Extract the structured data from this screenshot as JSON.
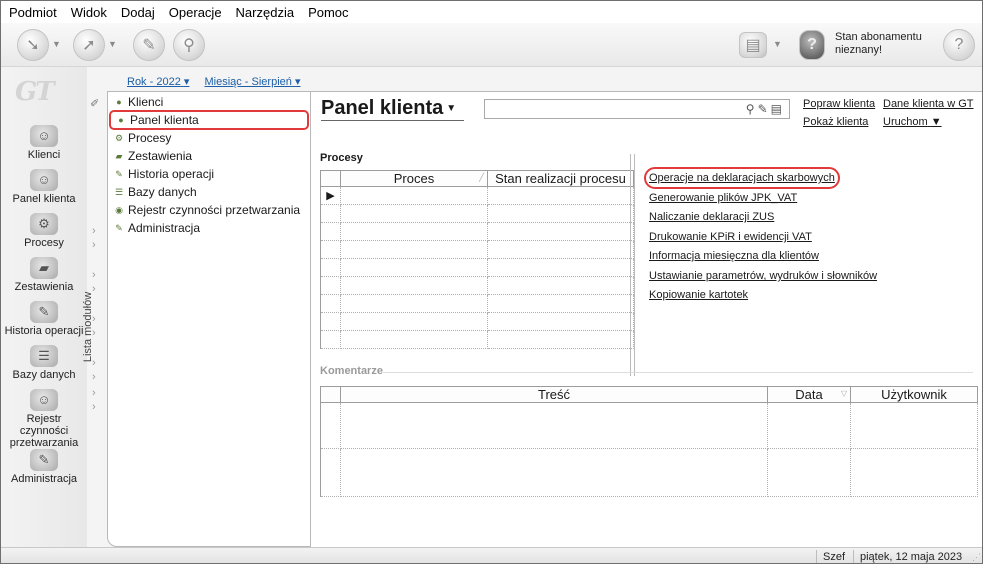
{
  "menu": [
    "Podmiot",
    "Widok",
    "Dodaj",
    "Operacje",
    "Narzędzia",
    "Pomoc"
  ],
  "subscription": {
    "line1": "Stan abonamentu",
    "line2": "nieznany!"
  },
  "logo": "GT",
  "nav": [
    {
      "label": "Klienci",
      "icon": "client-icon"
    },
    {
      "label": "Panel klienta",
      "icon": "client-panel-icon"
    },
    {
      "label": "Procesy",
      "icon": "gears-icon"
    },
    {
      "label": "Zestawienia",
      "icon": "report-icon"
    },
    {
      "label": "Historia operacji",
      "icon": "history-icon"
    },
    {
      "label": "Bazy danych",
      "icon": "database-icon"
    },
    {
      "label": "Rejestr czynności przetwarzania",
      "icon": "register-icon"
    },
    {
      "label": "Administracja",
      "icon": "admin-icon"
    }
  ],
  "module_strip_label": "Lista modułów",
  "filters": {
    "year": "Rok - 2022",
    "month": "Miesiąc - Sierpień"
  },
  "tree": [
    {
      "label": "Klienci",
      "selected": false
    },
    {
      "label": "Panel klienta",
      "selected": true
    },
    {
      "label": "Procesy",
      "selected": false
    },
    {
      "label": "Zestawienia",
      "selected": false
    },
    {
      "label": "Historia operacji",
      "selected": false
    },
    {
      "label": "Bazy danych",
      "selected": false
    },
    {
      "label": "Rejestr czynności przetwarzania",
      "selected": false
    },
    {
      "label": "Administracja",
      "selected": false
    }
  ],
  "panel": {
    "title": "Panel klienta",
    "search_placeholder": "",
    "links": {
      "correct": "Popraw klienta",
      "data_in_gt": "Dane klienta w GT",
      "show": "Pokaż klienta",
      "run": "Uruchom"
    }
  },
  "processes": {
    "label": "Procesy",
    "columns": [
      "Proces",
      "Stan realizacji procesu"
    ],
    "row_count": 9
  },
  "operations": [
    {
      "label": "Operacje na deklaracjach skarbowych",
      "highlighted": true
    },
    {
      "label": "Generowanie plików JPK_VAT",
      "highlighted": false
    },
    {
      "label": "Naliczanie deklaracji ZUS",
      "highlighted": false
    },
    {
      "label": "Drukowanie KPiR i ewidencji VAT",
      "highlighted": false
    },
    {
      "label": "Informacja miesięczna dla klientów",
      "highlighted": false
    },
    {
      "label": "Ustawianie parametrów, wydruków i słowników",
      "highlighted": false
    },
    {
      "label": "Kopiowanie kartotek",
      "highlighted": false
    }
  ],
  "comments": {
    "label": "Komentarze",
    "columns": [
      "Treść",
      "Data",
      "Użytkownik"
    ]
  },
  "status": {
    "vault": "Szef",
    "date": "piątek, 12 maja 2023"
  },
  "colors": {
    "highlight": "#e23a3a",
    "link": "#1c5fa8"
  }
}
